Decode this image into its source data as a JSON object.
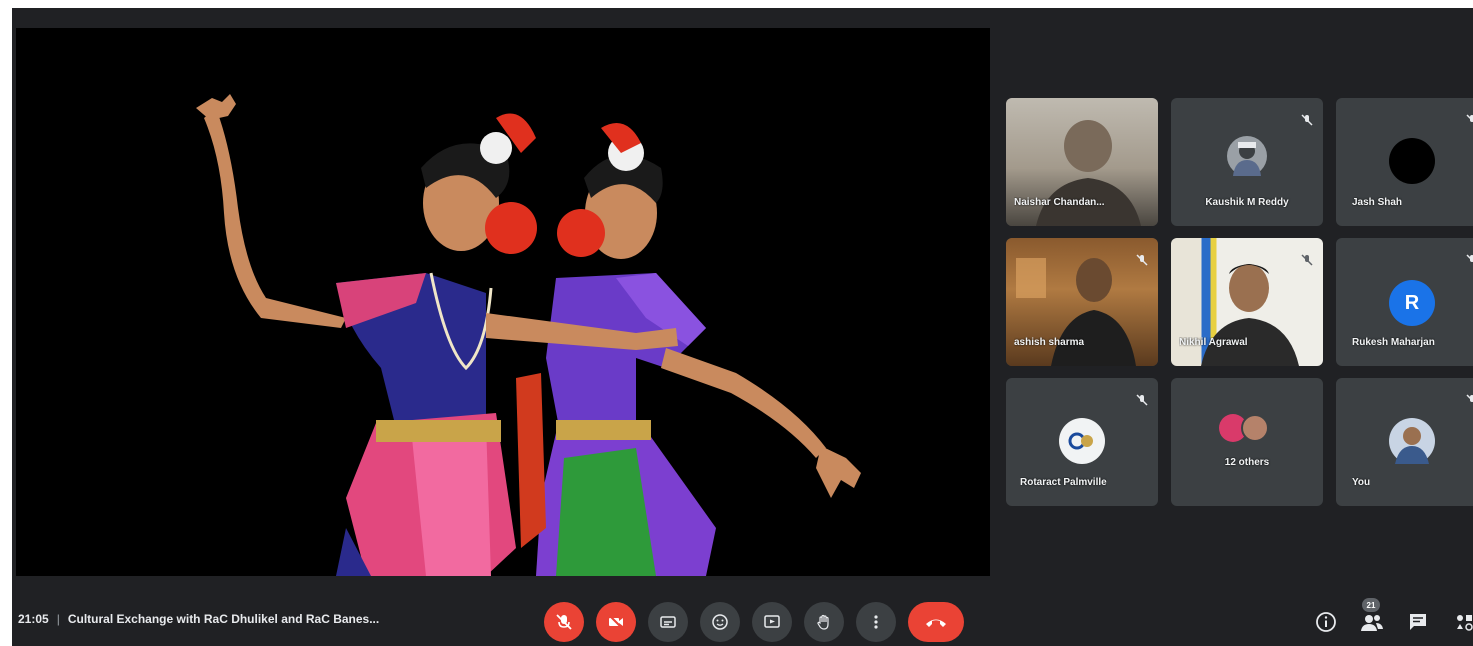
{
  "meeting": {
    "time": "21:05",
    "separator": "|",
    "title": "Cultural Exchange with RaC Dhulikel and RaC Banes..."
  },
  "participants": [
    {
      "name": "Naishar Chandan...",
      "type": "camera"
    },
    {
      "name": "Kaushik M Reddy",
      "type": "avatar-photo"
    },
    {
      "name": "Jash Shah",
      "type": "avatar-dark"
    },
    {
      "name": "ashish sharma",
      "type": "camera"
    },
    {
      "name": "Nikhil Agrawal",
      "type": "camera"
    },
    {
      "name": "Rukesh Maharjan",
      "type": "avatar-letter",
      "initial": "R"
    },
    {
      "name": "Rotaract Palmville",
      "type": "avatar-logo"
    },
    {
      "name": "12 others",
      "type": "group"
    },
    {
      "name": "You",
      "type": "avatar-photo"
    }
  ],
  "toolbar": {
    "people_count": "21"
  },
  "colors": {
    "background": "#202124",
    "tile": "#3c4043",
    "danger": "#ea4335",
    "avatar_blue": "#1a73e8"
  }
}
